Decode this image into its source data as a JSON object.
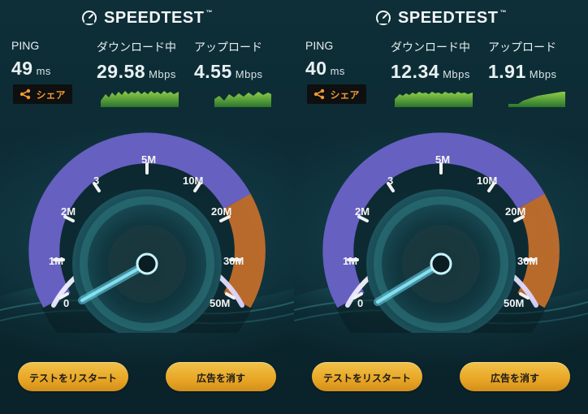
{
  "brand": {
    "name": "SPEEDTEST",
    "tm": "™"
  },
  "colors": {
    "accent": "#f29a2e",
    "button": "#e8a625",
    "gauge_purple": "#7f77d8",
    "gauge_orange": "#d77d32",
    "needle": "#8ad7e6"
  },
  "panels": [
    {
      "ping_label": "PING",
      "ping_value": "49",
      "ping_unit": "ms",
      "download_label": "ダウンロード中",
      "download_value": "29.58",
      "download_unit": "Mbps",
      "upload_label": "アップロード",
      "upload_value": "4.55",
      "upload_unit": "Mbps",
      "share_label": "シェア",
      "restart_label": "テストをリスタート",
      "remove_ads_label": "広告を消す",
      "needle_value_mbps": 0.6,
      "gauge_ticks": [
        "0",
        "1M",
        "2M",
        "3",
        "5M",
        "10M",
        "20M",
        "30M",
        "50M"
      ]
    },
    {
      "ping_label": "PING",
      "ping_value": "40",
      "ping_unit": "ms",
      "download_label": "ダウンロード中",
      "download_value": "12.34",
      "download_unit": "Mbps",
      "upload_label": "アップロード",
      "upload_value": "1.91",
      "upload_unit": "Mbps",
      "share_label": "シェア",
      "restart_label": "テストをリスタート",
      "remove_ads_label": "広告を消す",
      "needle_value_mbps": 0.7,
      "gauge_ticks": [
        "0",
        "1M",
        "2M",
        "3",
        "5M",
        "10M",
        "20M",
        "30M",
        "50M"
      ]
    }
  ]
}
